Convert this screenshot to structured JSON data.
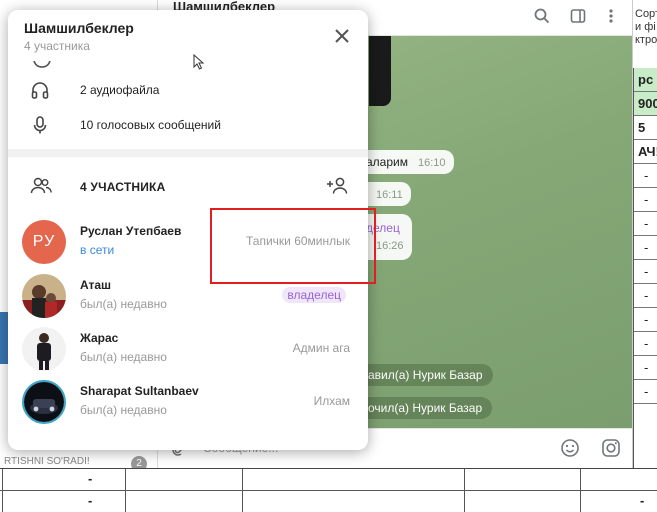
{
  "background_sheet": {
    "top_text": [
      "Сорт",
      "и фі",
      "ктро"
    ],
    "col_cells": [
      "рс",
      "900",
      "5",
      "АЧ!",
      "-",
      "-",
      "-",
      "-",
      "-",
      "-",
      "-",
      "-",
      "-",
      "-"
    ],
    "bottom_dashes": [
      "-",
      "-",
      "-"
    ]
  },
  "telegram": {
    "chat_title": "Шамшилбеклер",
    "left_snippet": "RTISHNI SO'RADI!",
    "left_badge": "2",
    "input_placeholder": "Сообщение...",
    "bubbles": [
      {
        "text": "аларим",
        "time": "16:10"
      },
      {
        "text": "",
        "time": "16:11"
      },
      {
        "text": "делец",
        "time": "16:26"
      }
    ],
    "service_messages": [
      "авил(а) Нурик Базар",
      "очил(а) Нурик Базар"
    ],
    "media_label": "10"
  },
  "modal": {
    "title": "Шамшилбеклер",
    "subtitle": "4 участника",
    "media_rows": [
      {
        "icon": "headphones-icon",
        "label": "2 аудиофайла"
      },
      {
        "icon": "microphone-icon",
        "label": "10 голосовых сообщений"
      }
    ],
    "members_header": "4 УЧАСТНИКА",
    "members": [
      {
        "initials": "РУ",
        "name": "Руслан Утепбаев",
        "status": "в сети",
        "role": "Тапички 60минлык",
        "online": true
      },
      {
        "initials": "",
        "name": "Аташ",
        "status": "был(а) недавно",
        "role": "владелец",
        "online": false
      },
      {
        "initials": "",
        "name": "Жарас",
        "status": "был(а) недавно",
        "role": "Админ ага",
        "online": false
      },
      {
        "initials": "",
        "name": "Sharapat Sultanbaev",
        "status": "был(а) недавно",
        "role": "Илхам",
        "online": false
      }
    ]
  },
  "colors": {
    "accent": "#3a8ad8",
    "owner_badge_bg": "#efe6fa",
    "owner_badge_text": "#9a63d6",
    "avatar_ru": "#e4664d",
    "highlight": "#e02020"
  }
}
